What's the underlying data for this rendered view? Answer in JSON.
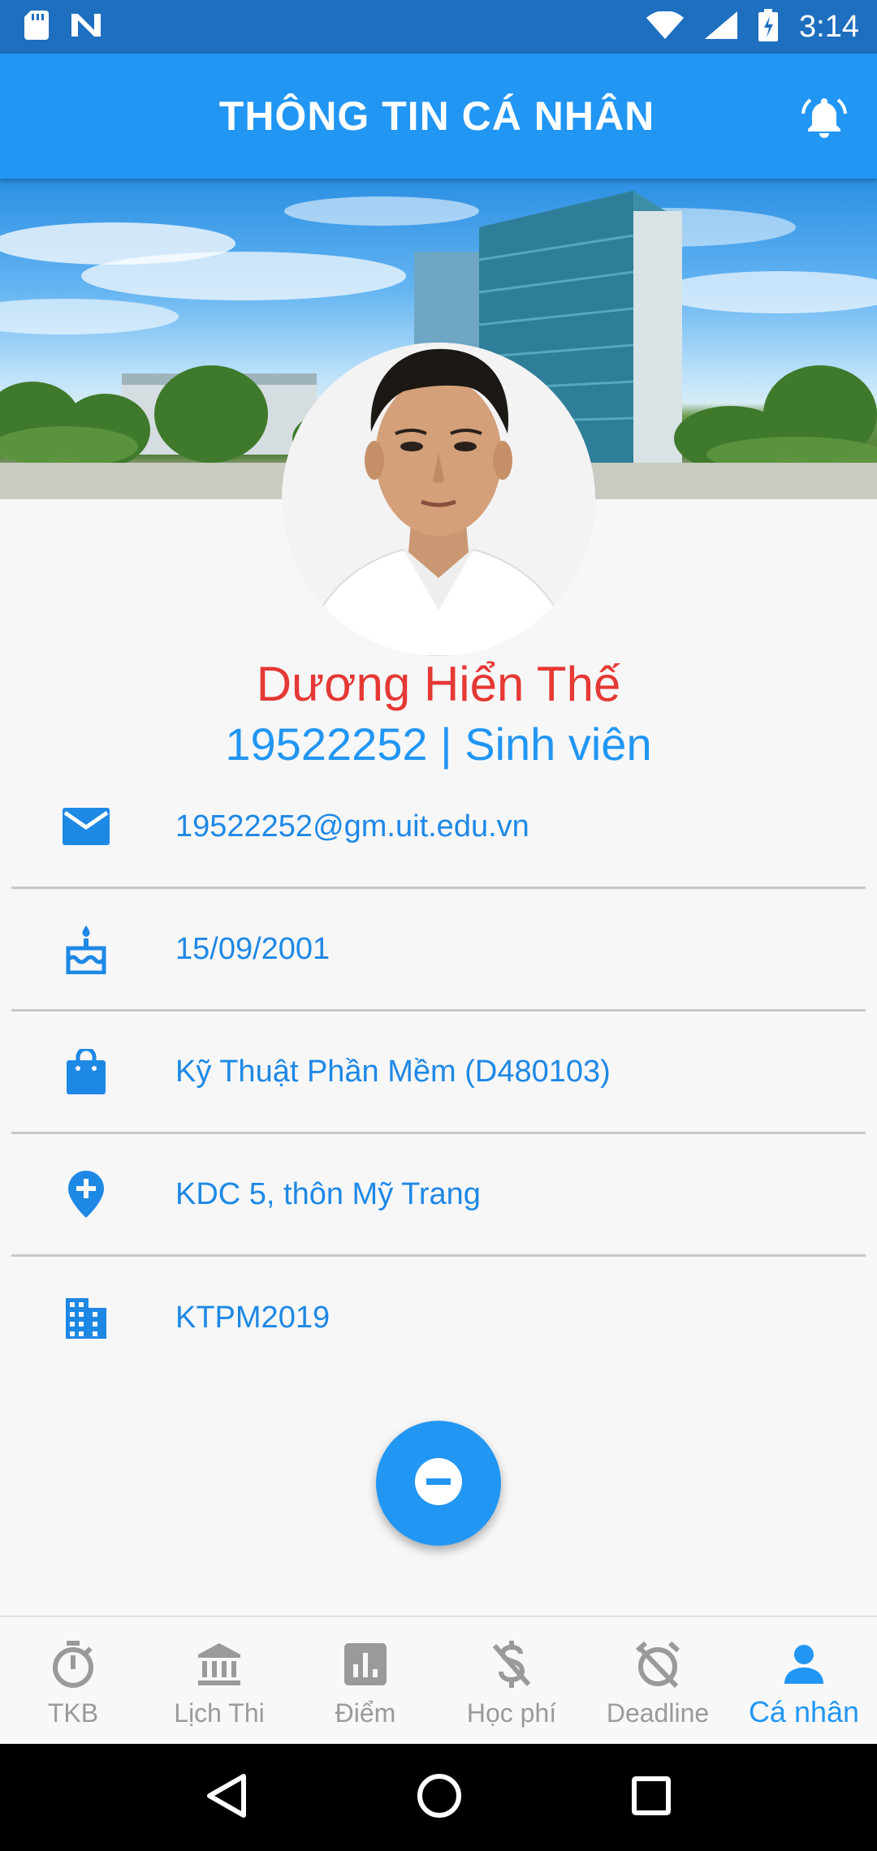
{
  "status_bar": {
    "time": "3:14",
    "icons": [
      "sd-card-icon",
      "n-logo-icon",
      "wifi-icon",
      "signal-icon",
      "battery-charging-icon"
    ],
    "color": "#1e6fbf"
  },
  "app_bar": {
    "title": "THÔNG TIN CÁ NHÂN",
    "action_icon": "bell-ring-icon",
    "color": "#2196f3"
  },
  "profile": {
    "name": "Dương Hiển Thế",
    "id_role": "19522252 | Sinh viên",
    "name_color": "#e53935",
    "accent_color": "#2196f3"
  },
  "info": {
    "email": "19522252@gm.uit.edu.vn",
    "birthday": "15/09/2001",
    "major": "Kỹ Thuật Phần Mềm (D480103)",
    "address": "KDC 5, thôn Mỹ Trang",
    "class": "KTPM2019"
  },
  "fab": {
    "icon": "minus-circle-icon"
  },
  "bottom_nav": {
    "items": [
      {
        "label": "TKB",
        "icon": "stopwatch-icon"
      },
      {
        "label": "Lịch Thi",
        "icon": "bank-icon"
      },
      {
        "label": "Điểm",
        "icon": "chart-icon"
      },
      {
        "label": "Học phí",
        "icon": "money-off-icon"
      },
      {
        "label": "Deadline",
        "icon": "alarm-off-icon"
      },
      {
        "label": "Cá nhân",
        "icon": "person-icon"
      }
    ],
    "active_index": 5,
    "active_color": "#2196f3",
    "inactive_color": "#9a9a9a"
  }
}
